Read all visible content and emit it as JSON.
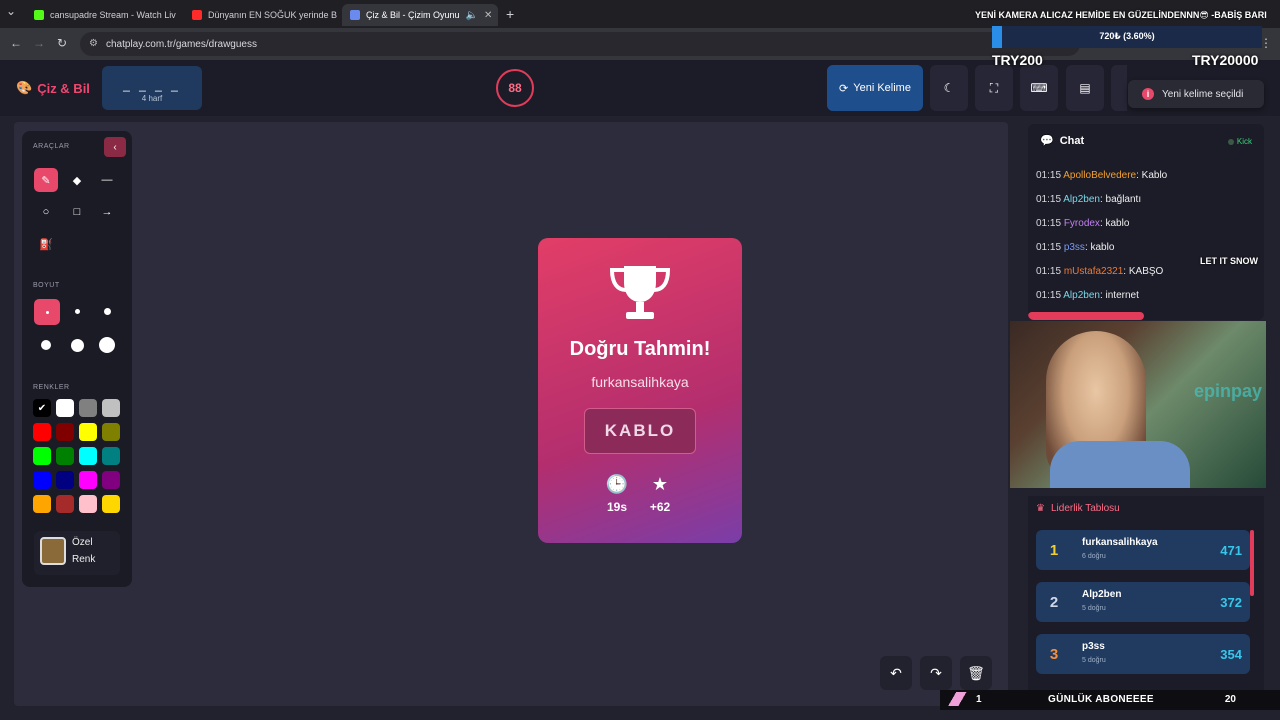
{
  "browser": {
    "tabs": [
      {
        "title": "cansupadre Stream - Watch Liv",
        "color": "#53fc18"
      },
      {
        "title": "Dünyanın EN SOĞUK yerinde B",
        "color": "#ff2a2a"
      },
      {
        "title": "Çiz & Bil - Çizim Oyunu",
        "color": "#6a8af0"
      }
    ],
    "url": "chatplay.com.tr/games/drawguess"
  },
  "header": {
    "logo": "Çiz & Bil",
    "word_mask": "_ _ _ _",
    "word_length": "4 harf",
    "timer": "88",
    "new_word_label": "Yeni Kelime"
  },
  "toast": {
    "text": "Yeni kelime seçildi"
  },
  "overlay": {
    "title": "YENİ KAMERA ALICAZ HEMİDE EN GÜZELİNDENNN😎 -BABİŞ BARI",
    "progress_text": "720₺ (3.60%)",
    "progress_fraction": 0.036,
    "min_label": "TRY200",
    "max_label": "TRY20000"
  },
  "tools": {
    "section_tools": "ARAÇLAR",
    "section_size": "BOYUT",
    "section_colors": "RENKLER",
    "custom_color_label": "Özel Renk",
    "colors": [
      "#000000",
      "#ffffff",
      "#808080",
      "#c0c0c0",
      "#ff0000",
      "#800000",
      "#ffff00",
      "#808000",
      "#00ff00",
      "#008000",
      "#00ffff",
      "#008080",
      "#0000ff",
      "#000080",
      "#ff00ff",
      "#800080",
      "#ffa500",
      "#a52a2a",
      "#ffc0cb",
      "#ffd700"
    ]
  },
  "result": {
    "title": "Doğru Tahmin!",
    "winner": "furkansalihkaya",
    "word": "KABLO",
    "time": "19s",
    "points": "+62"
  },
  "chat": {
    "title": "Chat",
    "source": "Kick",
    "messages": [
      {
        "time": "01:15",
        "user": "ApolloBelvedere",
        "color": "#f0a030",
        "text": ": Kablo"
      },
      {
        "time": "01:15",
        "user": "Alp2ben",
        "color": "#7ad8e8",
        "text": ": bağlantı"
      },
      {
        "time": "01:15",
        "user": "Fyrodex",
        "color": "#c080f0",
        "text": ": kablo"
      },
      {
        "time": "01:15",
        "user": "p3ss",
        "color": "#7a9af0",
        "text": ": kablo"
      },
      {
        "time": "01:15",
        "user": "mUstafa2321",
        "color": "#f07a30",
        "text": ": KABŞO"
      },
      {
        "time": "01:15",
        "user": "Alp2ben",
        "color": "#7ad8e8",
        "text": ": internet"
      }
    ]
  },
  "webcam": {
    "brand": "epinpay",
    "sticker": "LET IT SNOW"
  },
  "leaderboard": {
    "title": "Liderlik Tablosu",
    "rows": [
      {
        "rank": "1",
        "name": "furkansalihkaya",
        "sub": "6 doğru",
        "points": "471",
        "color": "#f0d030"
      },
      {
        "rank": "2",
        "name": "Alp2ben",
        "sub": "5 doğru",
        "points": "372",
        "color": "#d0d8e8"
      },
      {
        "rank": "3",
        "name": "p3ss",
        "sub": "5 doğru",
        "points": "354",
        "color": "#f09040"
      }
    ]
  },
  "subs": {
    "left": "1",
    "label": "GÜNLÜK ABONEEEE",
    "right": "20"
  }
}
